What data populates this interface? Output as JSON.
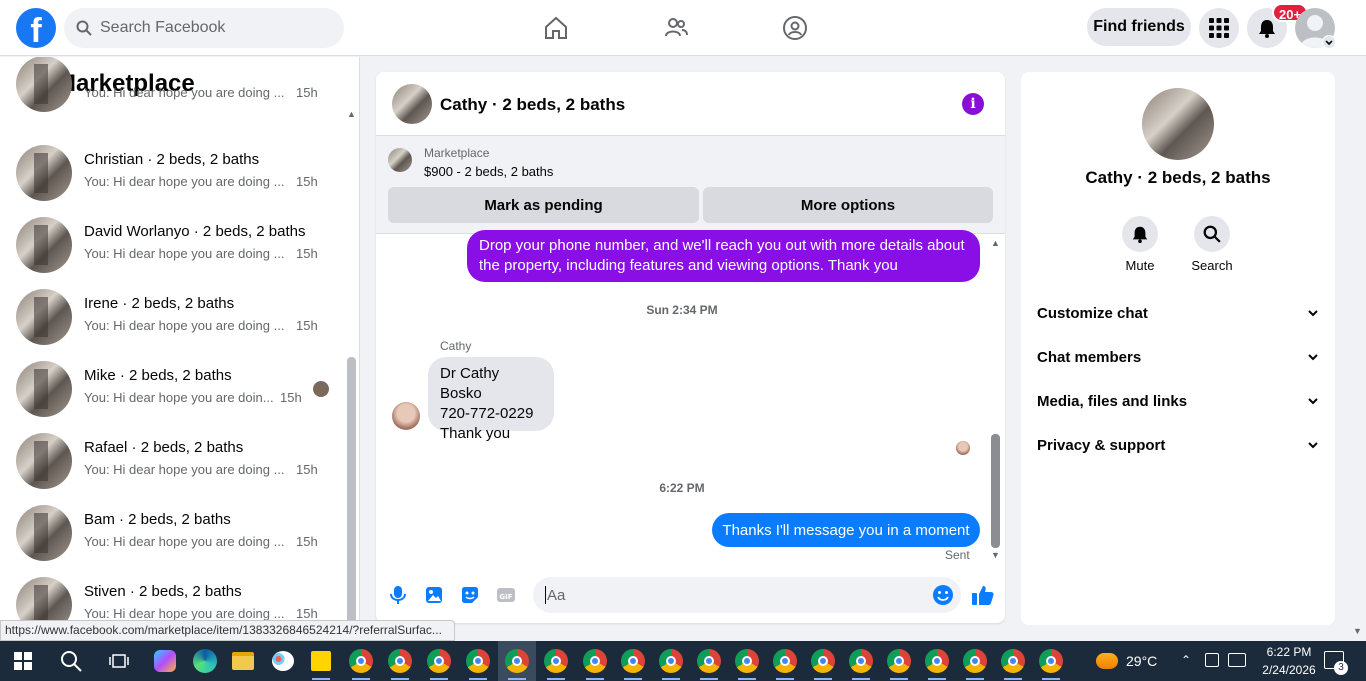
{
  "topbar": {
    "logo_letter": "f",
    "search_placeholder": "Search Facebook",
    "find_friends": "Find friends",
    "notification_count": "20+"
  },
  "left": {
    "title": "Marketplace",
    "conversations": [
      {
        "name": "",
        "snippet": "You: Hi dear hope you are doing ...",
        "time": "15h"
      },
      {
        "name": "Christian · 2 beds, 2 baths",
        "snippet": "You: Hi dear hope you are doing ...",
        "time": "15h"
      },
      {
        "name": "David Worlanyo · 2 beds, 2 baths",
        "snippet": "You: Hi dear hope you are doing ...",
        "time": "15h"
      },
      {
        "name": "Irene · 2 beds, 2 baths",
        "snippet": "You: Hi dear hope you are doing ...",
        "time": "15h"
      },
      {
        "name": "Mike · 2 beds, 2 baths",
        "snippet": "You: Hi dear hope you are doin...",
        "time": "15h"
      },
      {
        "name": "Rafael · 2 beds, 2 baths",
        "snippet": "You: Hi dear hope you are doing ...",
        "time": "15h"
      },
      {
        "name": "Bam · 2 beds, 2 baths",
        "snippet": "You: Hi dear hope you are doing ...",
        "time": "15h"
      },
      {
        "name": "Stiven · 2 beds, 2 baths",
        "snippet": "You: Hi dear hope you are doing ...",
        "time": "15h"
      }
    ]
  },
  "chat": {
    "title": "Cathy · 2 beds, 2 baths",
    "listing_label": "Marketplace",
    "listing_price": "$900 - 2 beds, 2 baths",
    "mark_pending": "Mark as pending",
    "more_options": "More options",
    "msg_outgoing_1": "Drop your phone number, and we'll reach you out with more details about the property, including features and viewing options.  Thank you",
    "ts_1": "Sun 2:34 PM",
    "sender": "Cathy",
    "incoming_line1": "Dr Cathy Bosko",
    "incoming_line2": "720-772-0229",
    "incoming_line3": "Thank you",
    "ts_2": "6:22 PM",
    "msg_outgoing_2": "Thanks I'll message you in a moment",
    "sent_status": "Sent",
    "input_placeholder": "Aa"
  },
  "right": {
    "name": "Cathy · 2 beds, 2 baths",
    "mute": "Mute",
    "search": "Search",
    "sections": [
      "Customize chat",
      "Chat members",
      "Media, files and links",
      "Privacy & support"
    ]
  },
  "statusbar": {
    "url": "https://www.facebook.com/marketplace/item/1383326846524214/?referralSurfac..."
  },
  "taskbar": {
    "temperature": "29°C",
    "time": "6:22 PM",
    "date": "2/24/2026",
    "notif_count": "3"
  },
  "colors": {
    "brand": "#1877f2",
    "purple": "#8a0fe6",
    "blue_bubble": "#0a7cff"
  }
}
